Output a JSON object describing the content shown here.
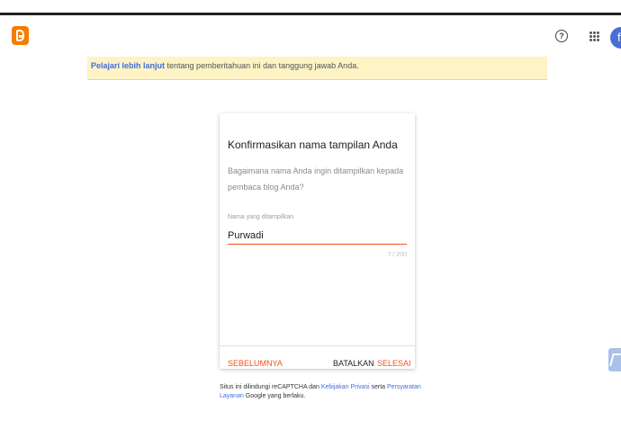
{
  "header": {
    "logo_icon": "blogger-logo-icon",
    "help_icon_glyph": "?",
    "avatar_initial": "f"
  },
  "notice": {
    "link_text": "Pelajari lebih lanjut",
    "text": " tentang pemberitahuan ini dan tanggung jawab Anda."
  },
  "dialog": {
    "title": "Konfirmasikan nama tampilan Anda",
    "description": "Bagaimana nama Anda ingin ditampilkan kepada pembaca blog Anda?",
    "field_label": "Nama yang ditampilkan",
    "field_value": "Purwadi",
    "counter": "7 / 200",
    "buttons": {
      "previous": "SEBELUMNYA",
      "cancel": "BATALKAN",
      "done": "SELESAI"
    }
  },
  "footer": {
    "text_1": "Situs ini dilindungi reCAPTCHA dan ",
    "privacy_link": "Kebijakan Privasi",
    "text_2": " serta ",
    "terms_link": "Persyaratan Layanan",
    "text_3": " Google yang berlaku."
  },
  "colors": {
    "accent": "#f4511e",
    "brand": "#f57d00",
    "link": "#3f6de0",
    "notice_bg": "#fdf3c5"
  }
}
